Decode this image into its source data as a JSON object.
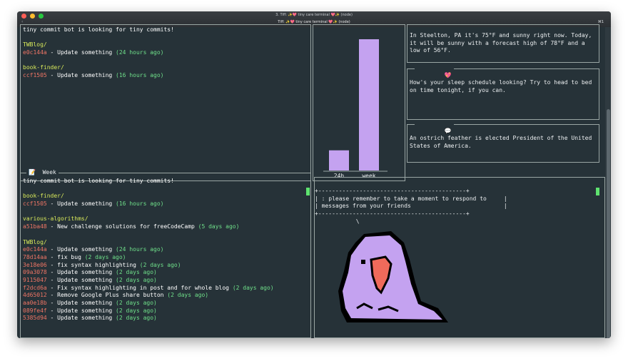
{
  "window": {
    "title": "3. Tiff: ✨💖 tiny care terminal 💖✨ (node)",
    "tab_title": "Tiff: ✨💖 tiny care terminal 💖✨ (node)",
    "back_glyph": "‹",
    "shortcut": "⌘1"
  },
  "today_panel": {
    "intro": "tiny commit bot is looking for tiny commits!",
    "groups": [
      {
        "repo": "TWBlog/",
        "commits": [
          {
            "hash": "e0c144a",
            "msg": " - Update something ",
            "age": "(24 hours ago)"
          }
        ]
      },
      {
        "repo": "book-finder/",
        "commits": [
          {
            "hash": "ccf1505",
            "msg": " - Update something ",
            "age": "(16 hours ago)"
          }
        ]
      }
    ]
  },
  "week_panel": {
    "title": "📝  Week",
    "intro": "tiny commit bot is looking for tiny commits!",
    "groups": [
      {
        "repo": "book-finder/",
        "commits": [
          {
            "hash": "ccf1505",
            "msg": " - Update something ",
            "age": "(16 hours ago)"
          }
        ]
      },
      {
        "repo": "various-algorithms/",
        "commits": [
          {
            "hash": "a51ba48",
            "msg": " - New challenge solutions for freeCodeCamp ",
            "age": "(5 days ago)"
          }
        ]
      },
      {
        "repo": "TWBlog/",
        "commits": [
          {
            "hash": "e0c144a",
            "msg": " - Update something ",
            "age": "(24 hours ago)"
          },
          {
            "hash": "78d14aa",
            "msg": " - fix bug ",
            "age": "(2 days ago)"
          },
          {
            "hash": "3e18e06",
            "msg": " - fix syntax highlighting ",
            "age": "(2 days ago)"
          },
          {
            "hash": "09a3078",
            "msg": " - Update something ",
            "age": "(2 days ago)"
          },
          {
            "hash": "9115047",
            "msg": " - Update something ",
            "age": "(2 days ago)"
          },
          {
            "hash": "f2dcd6a",
            "msg": " - Fix syntax highlighting in post and for whole blog ",
            "age": "(2 days ago)"
          },
          {
            "hash": "4d65012",
            "msg": " - Remove Google Plus share button ",
            "age": "(2 days ago)"
          },
          {
            "hash": "aa0e18b",
            "msg": " - Update something ",
            "age": "(2 days ago)"
          },
          {
            "hash": "089fe4f",
            "msg": " - Update something ",
            "age": "(2 days ago)"
          },
          {
            "hash": "5385d94",
            "msg": " - Update something ",
            "age": "(2 days ago)"
          }
        ]
      }
    ]
  },
  "chart_data": {
    "type": "bar",
    "categories": [
      "24h",
      "week"
    ],
    "values": [
      2,
      13
    ],
    "ylim": [
      0,
      13
    ]
  },
  "weather": {
    "lines": [
      "In Steelton, PA it's 75°F and sunny right now. Today,",
      "it will be sunny with a forecast high of 78°F and a",
      "low of 56°F."
    ]
  },
  "sleep": {
    "icon": "💖",
    "lines": [
      "How's your sleep schedule looking? Try to head to bed",
      "on time tonight, if you can."
    ]
  },
  "news": {
    "icon": "💬",
    "lines": [
      "An ostrich feather is elected President of the United",
      "States of America."
    ]
  },
  "party_parrot": {
    "lines": [
      "+-------------------------------------------+",
      "| : please remember to take a moment to respond to     |",
      "| messages from your friends                           |",
      "+-------------------------------------------+",
      "            \\"
    ]
  },
  "colors": {
    "background": "#263238",
    "hash": "#ef7565",
    "repo": "#d9ea5a",
    "age": "#6fe08a",
    "bar": "#c4a2f0",
    "cursor": "#5ee36f",
    "bird_body": "#c4a2f0",
    "bird_beak": "#f06a5b"
  }
}
